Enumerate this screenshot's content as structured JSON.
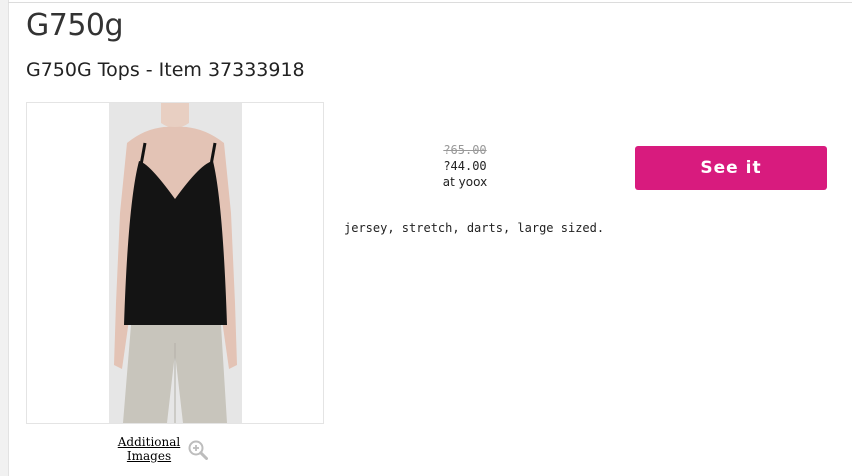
{
  "brand": {
    "name": "G750g"
  },
  "product": {
    "title": "G750G Tops - Item 37333918",
    "image_alt": "black sleeveless top",
    "additional_images_label": "Additional Images",
    "description": "jersey, stretch, darts, large sized."
  },
  "pricing": {
    "original_price": "?65.00",
    "sale_price": "?44.00",
    "retailer": "at yoox"
  },
  "actions": {
    "see_it_label": "See it"
  },
  "colors": {
    "accent": "#d81b7e",
    "photo_background": "#e6e6e6",
    "top_color": "#111111"
  },
  "icons": {
    "zoom": "zoom-in-icon"
  }
}
